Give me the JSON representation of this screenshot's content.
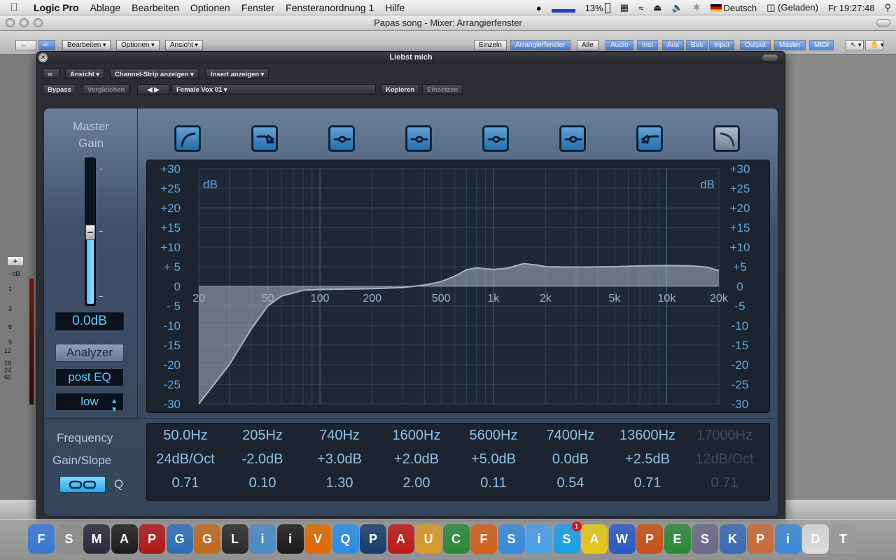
{
  "menubar": {
    "app": "Logic Pro",
    "items": [
      "Ablage",
      "Bearbeiten",
      "Optionen",
      "Fenster",
      "Fensteranordnung 1",
      "Hilfe"
    ],
    "battery_percent": "13%",
    "language": "Deutsch",
    "power_status": "(Geladen)",
    "clock": "Fr 19:27:48"
  },
  "main_window": {
    "title": "Papas song - Mixer: Arrangierfenster",
    "toolbar": {
      "edit_menu": "Bearbeiten",
      "options_menu": "Optionen",
      "view_menu": "Ansicht",
      "mode_buttons": [
        "Einzeln",
        "Arrangierfenster",
        "Alle"
      ],
      "filter_buttons": [
        "Audio",
        "Inst",
        "Aux",
        "Bus",
        "Input",
        "Output",
        "Master",
        "MIDI"
      ]
    },
    "meter_scale": [
      "- dB",
      "1",
      "3",
      "6",
      "9",
      "12",
      "18",
      "24",
      "60"
    ]
  },
  "plugin": {
    "title": "Liebst mich",
    "view_menu": "Ansicht",
    "channel_strip_menu": "Channel-Strip anzeigen",
    "insert_menu": "Insert anzeigen",
    "bypass": "Bypass",
    "compare": "Vergleichen",
    "preset": "Female Vox 01",
    "copy": "Kopieren",
    "paste": "Einsetzen"
  },
  "eq": {
    "master_gain_label": "Master Gain",
    "master_gain_value": "0.0dB",
    "master_gain_db": 0.0,
    "analyzer_label": "Analyzer",
    "analyzer_mode": "post EQ",
    "analyzer_resolution": "low",
    "db_unit": "dB",
    "db_ticks": [
      "+30",
      "+25",
      "+20",
      "+15",
      "+10",
      "+ 5",
      "0",
      "- 5",
      "-10",
      "-15",
      "-20",
      "-25",
      "-30"
    ],
    "db_ticks_right": [
      "+30",
      "+25",
      "+20",
      "+15",
      "+10",
      "+5",
      "0",
      "-5",
      "-10",
      "-15",
      "-20",
      "-25",
      "-30"
    ],
    "freq_ticks": [
      "20",
      "50",
      "100",
      "200",
      "500",
      "1k",
      "2k",
      "5k",
      "10k",
      "20k"
    ],
    "row_labels": {
      "frequency": "Frequency",
      "gain": "Gain/Slope",
      "q": "Q"
    },
    "bands": [
      {
        "type": "low-cut",
        "frequency": "50.0Hz",
        "gain": "24dB/Oct",
        "q": "0.71",
        "enabled": true
      },
      {
        "type": "low-shelf",
        "frequency": "205Hz",
        "gain": "-2.0dB",
        "q": "0.10",
        "enabled": true
      },
      {
        "type": "bell",
        "frequency": "740Hz",
        "gain": "+3.0dB",
        "q": "1.30",
        "enabled": true
      },
      {
        "type": "bell",
        "frequency": "1600Hz",
        "gain": "+2.0dB",
        "q": "2.00",
        "enabled": true
      },
      {
        "type": "bell",
        "frequency": "5600Hz",
        "gain": "+5.0dB",
        "q": "0.11",
        "enabled": true
      },
      {
        "type": "bell",
        "frequency": "7400Hz",
        "gain": "0.0dB",
        "q": "0.54",
        "enabled": true
      },
      {
        "type": "high-shelf",
        "frequency": "13600Hz",
        "gain": "+2.5dB",
        "q": "0.71",
        "enabled": true
      },
      {
        "type": "high-cut",
        "frequency": "17000Hz",
        "gain": "12dB/Oct",
        "q": "0.71",
        "enabled": false
      }
    ],
    "curve": {
      "freq_hz": [
        20,
        30,
        40,
        50,
        60,
        80,
        100,
        150,
        200,
        300,
        400,
        500,
        600,
        700,
        800,
        1000,
        1200,
        1500,
        1800,
        2000,
        3000,
        5000,
        7000,
        10000,
        14000,
        17000,
        20000
      ],
      "gain_db": [
        -30,
        -20,
        -11,
        -5,
        -2.5,
        -1,
        -0.8,
        -0.7,
        -0.6,
        -0.3,
        0.3,
        1.2,
        2.6,
        4.2,
        4.7,
        4.3,
        4.6,
        5.8,
        5.4,
        5.0,
        4.9,
        5.0,
        5.2,
        5.3,
        5.2,
        4.9,
        4.0
      ]
    }
  },
  "dock": {
    "apps": [
      "Finder",
      "System Preferences",
      "Mac OS X",
      "Activity Monitor",
      "Photo Booth",
      "Google Earth",
      "GarageBand",
      "Logic Pro",
      "iPhoto",
      "iMovie",
      "VLC",
      "QuickTime",
      "Photoshop",
      "Acrobat",
      "Uni",
      "Chrome",
      "Firefox",
      "Safari",
      "iTunes",
      "Skype",
      "Adium",
      "Word",
      "PowerPoint",
      "Excel",
      "Script Editor",
      "Keynote",
      "Preview",
      "iChat",
      "Documents",
      "Trash"
    ],
    "skype_badge": "1"
  }
}
